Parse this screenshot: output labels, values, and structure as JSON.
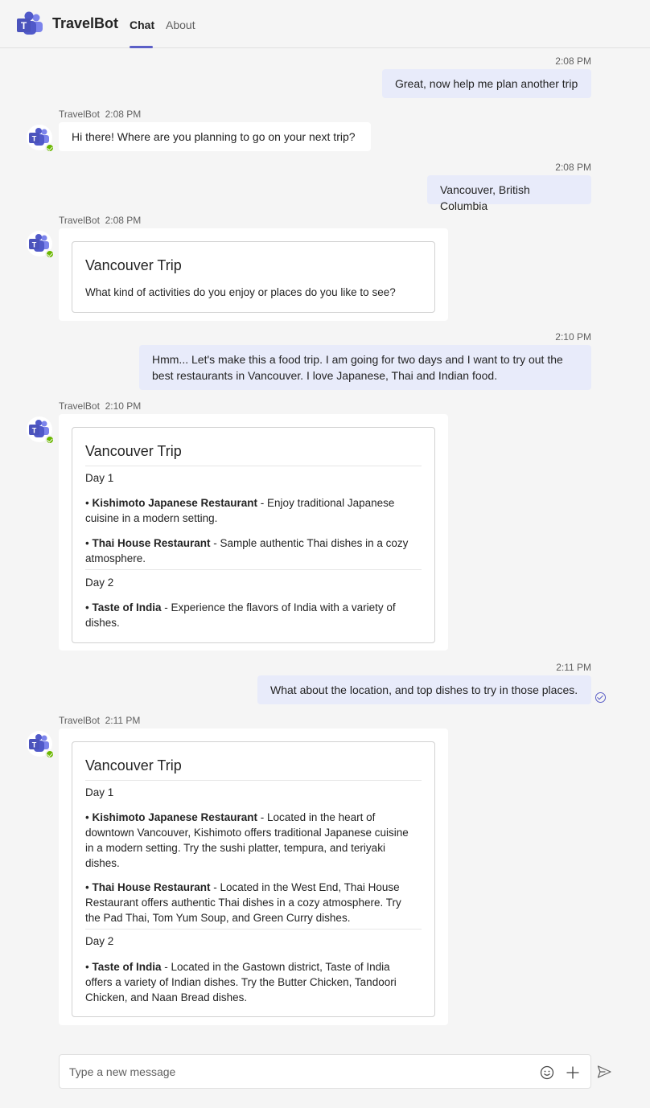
{
  "header": {
    "app_name": "TravelBot",
    "tabs": [
      {
        "label": "Chat",
        "active": true
      },
      {
        "label": "About",
        "active": false
      }
    ],
    "accent": "#5b5fc7"
  },
  "messages": {
    "m1": {
      "time": "2:08 PM",
      "text": "Great, now help me plan another trip"
    },
    "m2": {
      "sender": "TravelBot",
      "time": "2:08 PM",
      "text": "Hi there! Where are you planning to go on your next trip?"
    },
    "m3": {
      "time": "2:08 PM",
      "text": "Vancouver, British Columbia"
    },
    "m4": {
      "sender": "TravelBot",
      "time": "2:08 PM",
      "card_title": "Vancouver Trip",
      "card_text": "What kind of activities do you enjoy or places do you like to see?"
    },
    "m5": {
      "time": "2:10 PM",
      "line1": "Hmm... Let's make this a food trip. I am going for two days and I want to try out the",
      "line2": "best restaurants in Vancouver. I love Japanese, Thai and Indian food."
    },
    "m6": {
      "sender": "TravelBot",
      "time": "2:10 PM",
      "card_title": "Vancouver Trip",
      "day1": "Day 1",
      "r1_name": "Kishimoto Japanese Restaurant",
      "r1_l1": " - Enjoy traditional Japanese",
      "r1_l2": "cuisine in a modern setting.",
      "r2_name": "Thai House Restaurant",
      "r2_l1": " - Sample authentic Thai dishes in a cozy",
      "r2_l2": "atmosphere.",
      "day2": "Day 2",
      "r3_name": "Taste of India",
      "r3_l1": " - Experience the flavors of India with a variety of",
      "r3_l2": "dishes."
    },
    "m7": {
      "time": "2:11 PM",
      "text": "What about the location, and top dishes to try in those places."
    },
    "m8": {
      "sender": "TravelBot",
      "time": "2:11 PM",
      "card_title": "Vancouver Trip",
      "day1": "Day 1",
      "r1_name": "Kishimoto Japanese Restaurant",
      "r1_l1": " - Located in the heart of",
      "r1_l2": "downtown Vancouver, Kishimoto offers traditional Japanese cuisine",
      "r1_l3": "in a modern setting. Try the sushi platter, tempura, and teriyaki",
      "r1_l4": "dishes.",
      "r2_name": "Thai House Restaurant",
      "r2_l1": " - Located in the West End, Thai House",
      "r2_l2": "Restaurant offers authentic Thai dishes in a cozy atmosphere. Try",
      "r2_l3": "the Pad Thai, Tom Yum Soup, and Green Curry dishes.",
      "day2": "Day 2",
      "r3_name": "Taste of India",
      "r3_l1": " - Located in the Gastown district, Taste of India",
      "r3_l2": "offers a variety of Indian dishes. Try the Butter Chicken, Tandoori",
      "r3_l3": "Chicken, and Naan Bread dishes."
    }
  },
  "bullet": "• ",
  "compose": {
    "placeholder": "Type a new message"
  }
}
